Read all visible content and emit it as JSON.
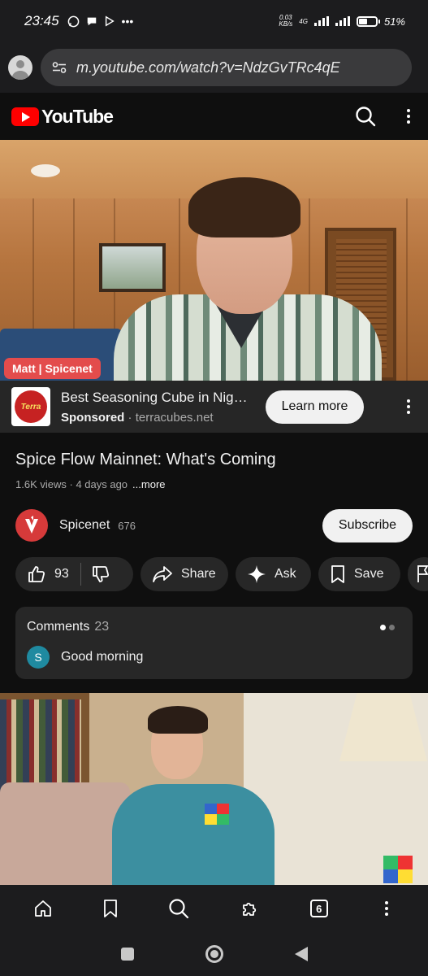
{
  "status_bar": {
    "time": "23:45",
    "net_speed_top": "0.03",
    "net_speed_bottom": "KB/s",
    "network": "4G",
    "battery": "51%",
    "battery_level": 0.51,
    "notification_icons": [
      "whatsapp-icon",
      "chat-icon",
      "play-store-icon",
      "more-dots"
    ]
  },
  "browser": {
    "url": "m.youtube.com/watch?v=NdzGvTRc4qE",
    "tab_count": "6"
  },
  "youtube": {
    "logo_text": "YouTube"
  },
  "player": {
    "speaker_tag": "Matt | Spicenet"
  },
  "ad": {
    "logo_text": "Terra",
    "title": "Best Seasoning Cube in Nigeria",
    "sponsored_label": "Sponsored",
    "separator": " · ",
    "domain": "terracubes.net",
    "cta_label": "Learn more"
  },
  "video": {
    "title": "Spice Flow Mainnet: What's Coming",
    "views": "1.6K views",
    "age": "4 days ago",
    "meta_separator": " · ",
    "more_label": "...more"
  },
  "channel": {
    "name": "Spicenet",
    "subscribers": "676",
    "subscribe_label": "Subscribe",
    "brand_color": "#d63a3a"
  },
  "actions": {
    "likes": "93",
    "share_label": "Share",
    "ask_label": "Ask",
    "save_label": "Save"
  },
  "comments": {
    "label": "Comments",
    "count": "23",
    "first_comment_initial": "S",
    "first_comment_text": "Good morning"
  },
  "colors": {
    "background": "#0f0f0f",
    "youtube_red": "#ff0000",
    "name_tag": "#e34c4c",
    "pill": "#272727"
  }
}
